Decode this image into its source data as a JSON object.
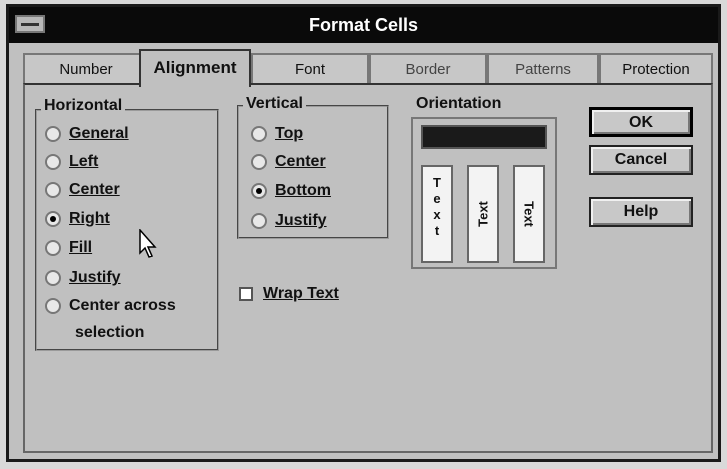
{
  "window": {
    "title": "Format Cells"
  },
  "tabs": [
    {
      "label": "Number"
    },
    {
      "label": "Alignment"
    },
    {
      "label": "Font"
    },
    {
      "label": "Border"
    },
    {
      "label": "Patterns"
    },
    {
      "label": "Protection"
    }
  ],
  "active_tab": "Alignment",
  "horizontal": {
    "label": "Horizontal",
    "options": [
      {
        "label": "General",
        "selected": false
      },
      {
        "label": "Left",
        "selected": false
      },
      {
        "label": "Center",
        "selected": false
      },
      {
        "label": "Right",
        "selected": true
      },
      {
        "label": "Fill",
        "selected": false
      },
      {
        "label": "Justify",
        "selected": false
      },
      {
        "label": "Center across",
        "label2": "selection",
        "selected": false
      }
    ]
  },
  "vertical": {
    "label": "Vertical",
    "options": [
      {
        "label": "Top",
        "selected": false
      },
      {
        "label": "Center",
        "selected": false
      },
      {
        "label": "Bottom",
        "selected": true
      },
      {
        "label": "Justify",
        "selected": false
      }
    ]
  },
  "wrap_text": {
    "label": "Wrap Text",
    "checked": false
  },
  "orientation": {
    "label": "Orientation",
    "samples": [
      "Text",
      "Text",
      "Text"
    ],
    "stacked_letters": [
      "T",
      "e",
      "x",
      "t"
    ]
  },
  "buttons": {
    "ok": "OK",
    "cancel": "Cancel",
    "help": "Help"
  },
  "icons": {
    "system_menu": "system-menu-icon",
    "cursor": "mouse-pointer-icon"
  }
}
